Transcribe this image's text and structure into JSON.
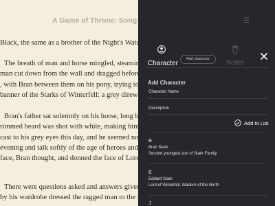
{
  "reader": {
    "book_title": "A Game of Throne:  Song of Ice",
    "paragraphs": [
      {
        "lines": [
          "Black, the same as a brother of the Night's Watch, except that"
        ]
      },
      {
        "lines": [
          "The breath of man and horse mingled, steaming, in the cold",
          "man cut down from the wall and dragged before them. Robb",
          ", with Bran between them on his pony, trying to seem older",
          "banner of the Starks of Winterfell: a grey direwolf racing ac"
        ]
      },
      {
        "lines": [
          "Bran's father sat solemnly on his horse, long brown hair",
          "rimmed beard was shot with white, making him look older th",
          "cast to his grey eyes this day, and he seemed not at all the",
          "evening and talk softly of the age of heroes and the children",
          "face, Bran thought, and donned the face of Lord Stark of"
        ]
      },
      {
        "lines": [
          "There were questions asked and answers given there in the",
          "by his wardrobe dressed the ragged man to the innocent of"
        ]
      }
    ]
  },
  "panel": {
    "tabs": {
      "character_label": "Character",
      "add_character_label": "Add character",
      "notes_label": "Notes"
    },
    "form": {
      "heading": "Add Character",
      "name_label": "Character Name",
      "description_label": "Description",
      "add_to_list_label": "Add to List"
    },
    "groups": [
      {
        "letter": "B",
        "entries": [
          {
            "name": "Bran Stark",
            "description": "Second youngest son of Stark Family"
          }
        ]
      },
      {
        "letter": "E",
        "entries": [
          {
            "name": "Eddard Stark",
            "description": "Lord of Winterfell, Wadern of the North"
          }
        ]
      },
      {
        "letter": "J",
        "entries": []
      }
    ]
  },
  "colors": {
    "page_background": "#f4eedd",
    "panel_background": "#26272b",
    "text_dark": "#2e2b27",
    "title_muted": "#b3ad9f",
    "panel_text": "#ffffff",
    "panel_muted": "#5b5c61"
  },
  "icons": {
    "character_tab": "user-icon",
    "notes_tab": "trash-icon",
    "close": "close-icon",
    "add_to_list": "check-circle-icon"
  }
}
